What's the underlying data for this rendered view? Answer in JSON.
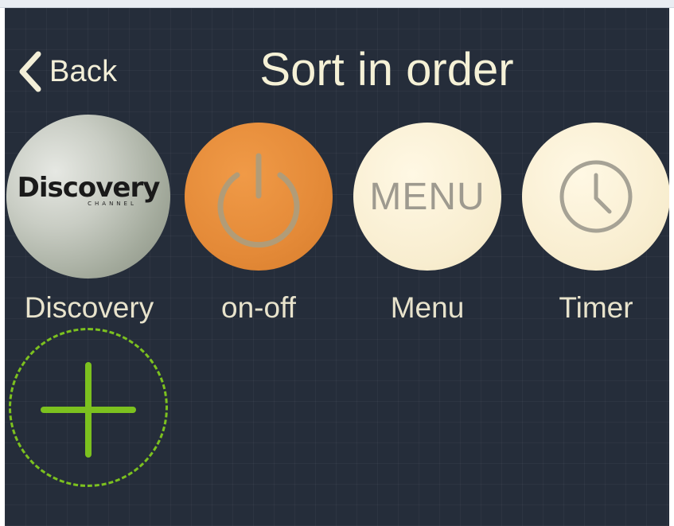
{
  "header": {
    "back_label": "Back",
    "title": "Sort in order"
  },
  "items": [
    {
      "label": "Discovery",
      "logo_text": "Discovery",
      "logo_sub": "CHANNEL",
      "icon": "discovery-logo"
    },
    {
      "label": "on-off",
      "icon": "power-icon"
    },
    {
      "label": "Menu",
      "icon_text": "MENU",
      "icon": "menu-text-icon"
    },
    {
      "label": "Timer",
      "icon": "clock-icon"
    }
  ],
  "add_button": {
    "icon": "plus-icon"
  },
  "colors": {
    "background": "#252d3a",
    "title_text": "#f5f1d6",
    "label_text": "#e8e3cc",
    "orange": "#e48a38",
    "cream": "#f8edcf",
    "accent_green": "#7cc11f"
  }
}
